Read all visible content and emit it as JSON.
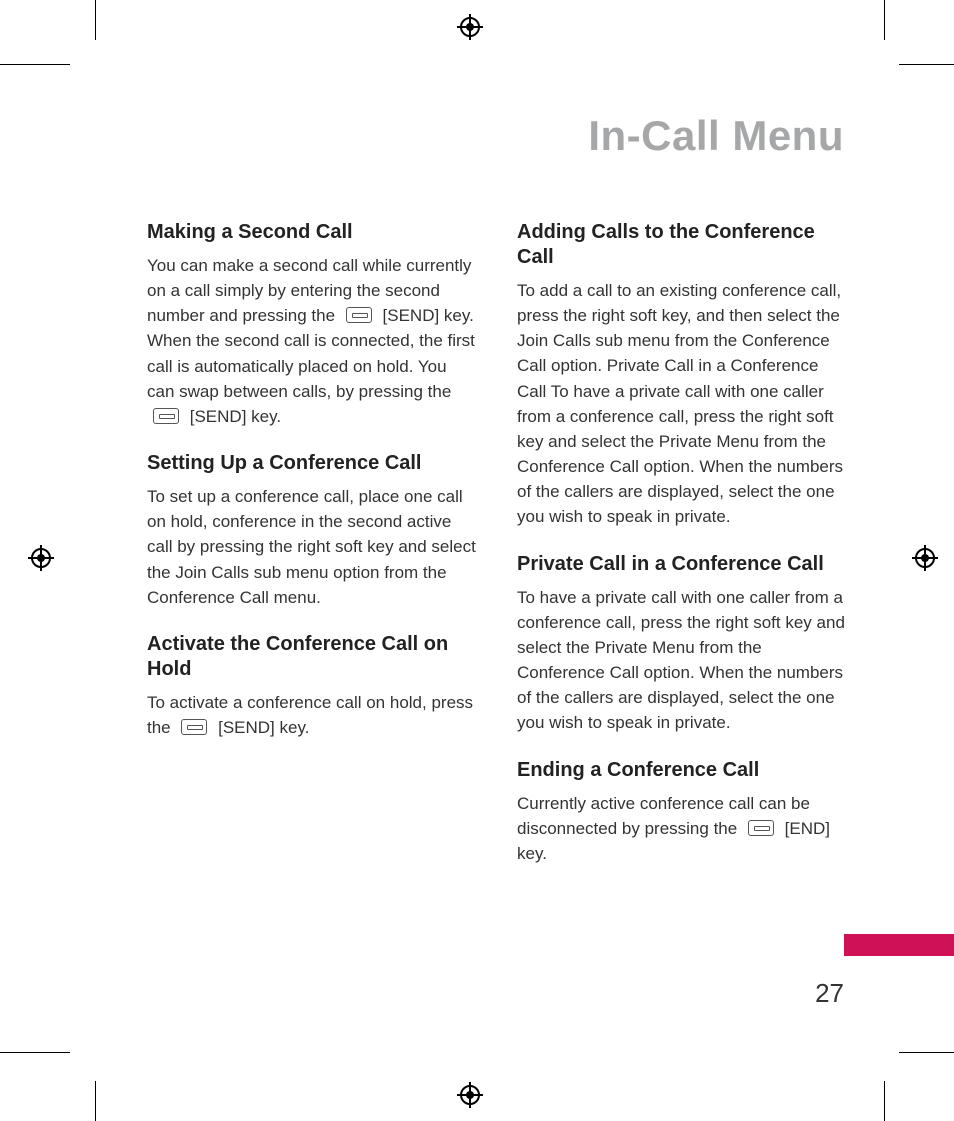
{
  "page": {
    "title": "In-Call Menu",
    "number": "27"
  },
  "left_column": [
    {
      "heading": "Making a Second Call",
      "body_parts": [
        "You can make a second call while currently on a call simply by entering the second number and pressing the ",
        " [SEND] key. When the second call is connected, the first call is automatically placed on hold. You can swap between calls, by pressing the ",
        " [SEND] key."
      ],
      "icons": [
        "send",
        "send"
      ]
    },
    {
      "heading": "Setting Up a Conference Call",
      "body": "To set up a conference call, place one call on hold, conference in the second active call by pressing the right soft key and select the Join Calls sub menu option from the Conference Call menu."
    },
    {
      "heading": "Activate the Conference Call on Hold",
      "body_parts": [
        "To activate a conference call on hold, press the ",
        " [SEND]  key."
      ],
      "icons": [
        "send"
      ]
    }
  ],
  "right_column": [
    {
      "heading": "Adding Calls to the Conference Call",
      "body": "To add a call to an existing conference call, press the right soft key, and then select the Join Calls sub menu from the Conference Call option. Private Call in a Conference Call To have a private call with one caller from a conference call, press the right soft key and select the Private Menu from the Conference Call option. When the numbers of the callers are displayed, select the one you wish to speak in private."
    },
    {
      "heading": "Private Call in a Conference Call",
      "body": "To have a private call with one caller from a conference call, press the right soft key and select the Private Menu from the Conference Call option. When the numbers of the callers are displayed, select the one you wish to speak in private."
    },
    {
      "heading": "Ending a Conference Call",
      "body_parts": [
        "Currently active conference call can be disconnected by pressing the ",
        " [END] key."
      ],
      "icons": [
        "end"
      ]
    }
  ]
}
